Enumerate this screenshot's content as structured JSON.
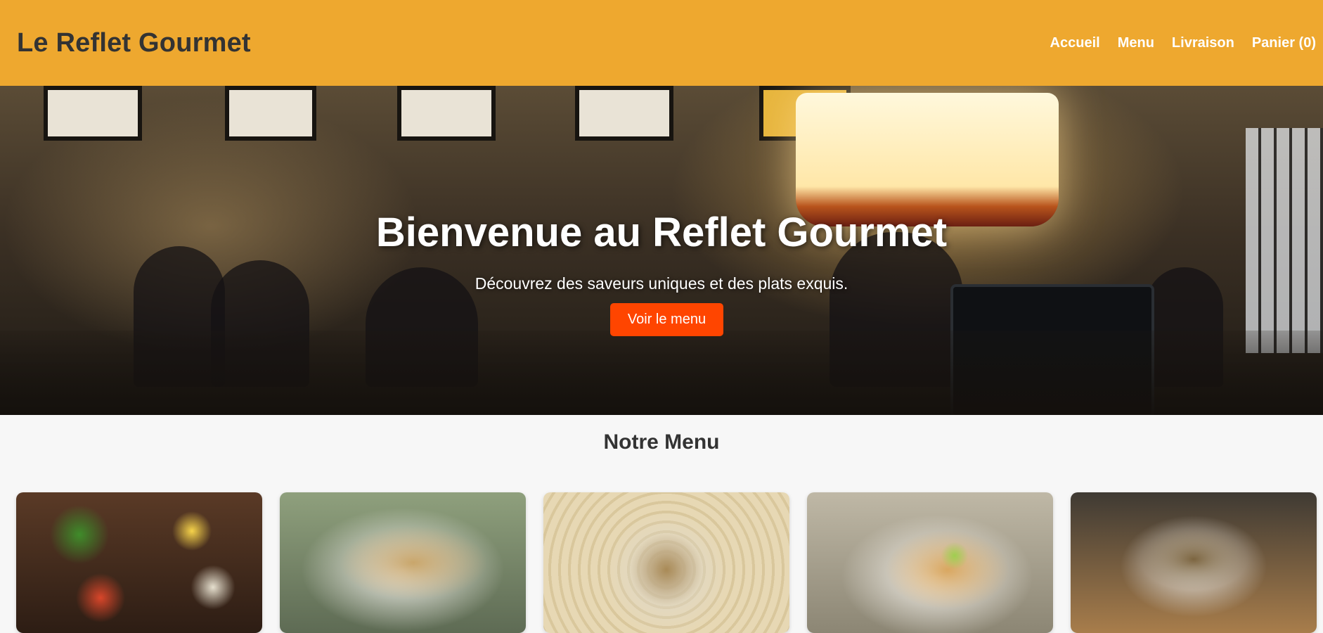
{
  "header": {
    "logo": "Le Reflet Gourmet",
    "nav": [
      "Accueil",
      "Menu",
      "Livraison",
      "Panier (0)"
    ]
  },
  "hero": {
    "title": "Bienvenue au Reflet Gourmet",
    "subtitle": "Découvrez des saveurs uniques et des plats exquis.",
    "button": "Voir le menu"
  },
  "menu": {
    "title": "Notre Menu",
    "items": [
      {
        "image": "salmon-salad-bowls"
      },
      {
        "image": "tortilla-wrap-plate"
      },
      {
        "image": "noodle-salad-plate"
      },
      {
        "image": "lime-toast-plate"
      },
      {
        "image": "creamy-soup-bowl"
      }
    ]
  },
  "colors": {
    "header_bg": "#eea82f",
    "button_bg": "#ff4500",
    "page_bg": "#f7f7f7"
  }
}
